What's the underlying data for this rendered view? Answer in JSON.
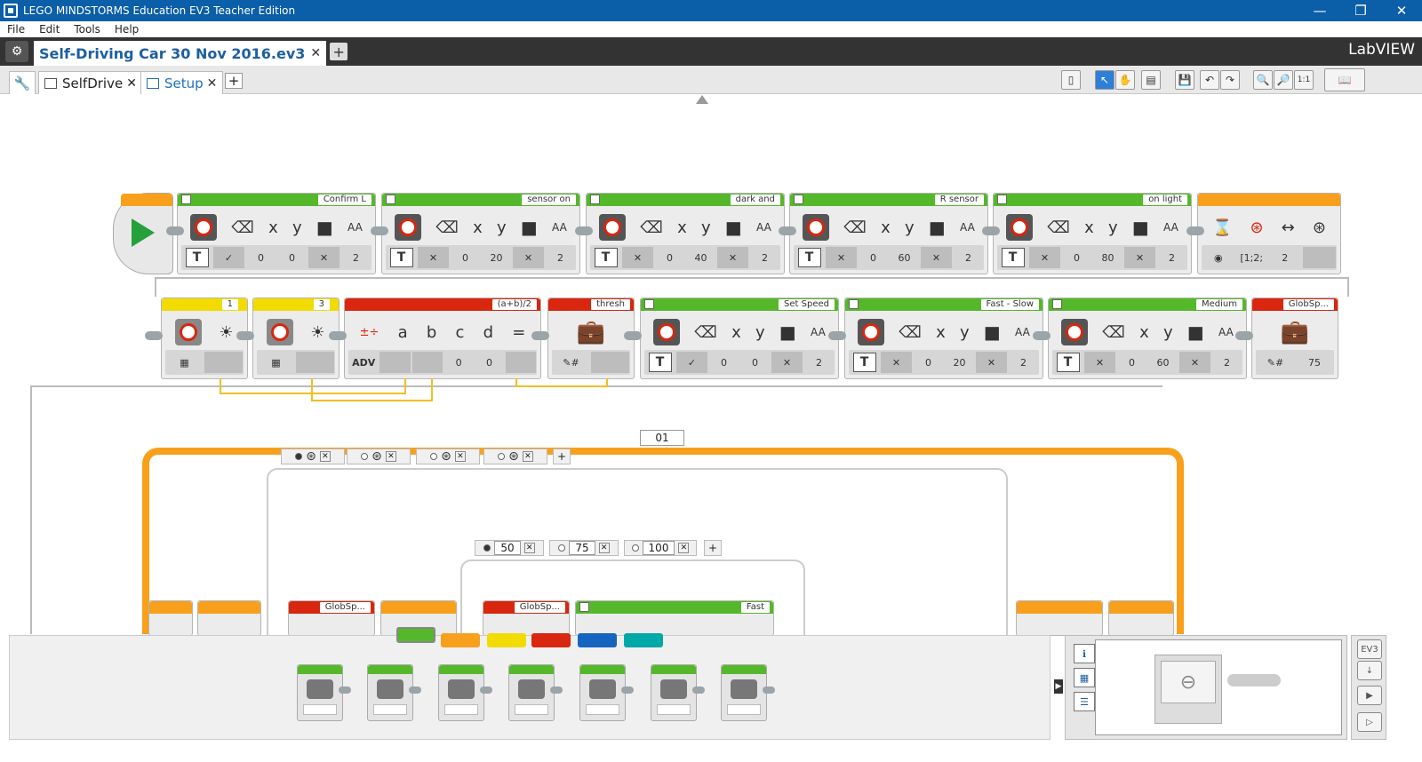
{
  "window": {
    "title": "LEGO MINDSTORMS Education EV3 Teacher Edition",
    "minimize": "—",
    "restore": "❐",
    "close": "✕"
  },
  "menu": [
    "File",
    "Edit",
    "Tools",
    "Help"
  ],
  "project": {
    "tab": "Self-Driving Car 30 Nov 2016.ev3",
    "close": "✕",
    "add": "+",
    "brand": "LabVIEW"
  },
  "programs": {
    "tabs": [
      {
        "label": "SelfDrive",
        "close": "✕"
      },
      {
        "label": "Setup",
        "close": "✕"
      }
    ],
    "add": "+"
  },
  "row1": [
    {
      "label": "Confirm L",
      "vals": [
        "✓",
        "0",
        "0",
        "✕",
        "2"
      ]
    },
    {
      "label": "sensor on",
      "vals": [
        "✕",
        "0",
        "20",
        "✕",
        "2"
      ]
    },
    {
      "label": "dark and",
      "vals": [
        "✕",
        "0",
        "40",
        "✕",
        "2"
      ]
    },
    {
      "label": "R sensor",
      "vals": [
        "✕",
        "0",
        "60",
        "✕",
        "2"
      ]
    },
    {
      "label": "on light",
      "vals": [
        "✕",
        "0",
        "80",
        "✕",
        "2"
      ]
    }
  ],
  "row1_params": [
    "x",
    "y",
    "AA"
  ],
  "wait_block": {
    "vals": [
      "[1;2;",
      "2"
    ]
  },
  "row2": {
    "sensor1": "1",
    "sensor2": "3",
    "math": {
      "label": "(a+b)/2",
      "vars": [
        "a",
        "b",
        "c",
        "d",
        "="
      ],
      "mode": "ADV",
      "vals": [
        "0",
        "0"
      ]
    },
    "var1": "thresh",
    "displays": [
      {
        "label": "Set Speed",
        "vals": [
          "✓",
          "0",
          "0",
          "✕",
          "2"
        ]
      },
      {
        "label": "Fast - Slow",
        "vals": [
          "✕",
          "0",
          "20",
          "✕",
          "2"
        ]
      },
      {
        "label": "Medium",
        "vals": [
          "✕",
          "0",
          "60",
          "✕",
          "2"
        ]
      }
    ],
    "var2": {
      "label": "GlobSp...",
      "val": "75"
    }
  },
  "loop": {
    "number": "01"
  },
  "switch_cases": [
    "50",
    "75",
    "100"
  ],
  "bottom_blocks": {
    "var1": "GlobSp...",
    "var2": "GlobSp...",
    "display": "Fast"
  },
  "palette": {
    "colors": [
      "#55b82a",
      "#f8a01c",
      "#f2dc00",
      "#d9260f",
      "#1565c0",
      "#00a8a8"
    ]
  },
  "ev3": {
    "label": "EV3"
  }
}
